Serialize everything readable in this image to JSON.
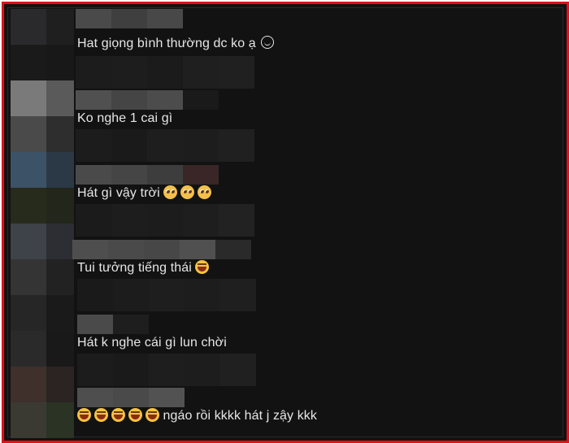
{
  "comments": [
    {
      "text": "Hat giọng bình thường dc ko ạ",
      "trailing_emoji": "smile-icon"
    },
    {
      "text": "Ko nghe 1 cai gì"
    },
    {
      "text": "Hát gì vậy trời",
      "trailing_emoji_count": 3,
      "trailing_emoji": "pleading-face-icon"
    },
    {
      "text": "Tui tưởng tiếng thái",
      "trailing_emoji": "laughing-face-icon"
    },
    {
      "text": "Hát k nghe cái gì lun chời"
    },
    {
      "leading_emoji_count": 5,
      "leading_emoji": "laughing-face-icon",
      "text": "ngáo rồi kkkk hát j zậy kkk"
    }
  ],
  "colors": {
    "frame_border": "#e0101c",
    "background": "#121212",
    "text": "#e6e6e6"
  }
}
